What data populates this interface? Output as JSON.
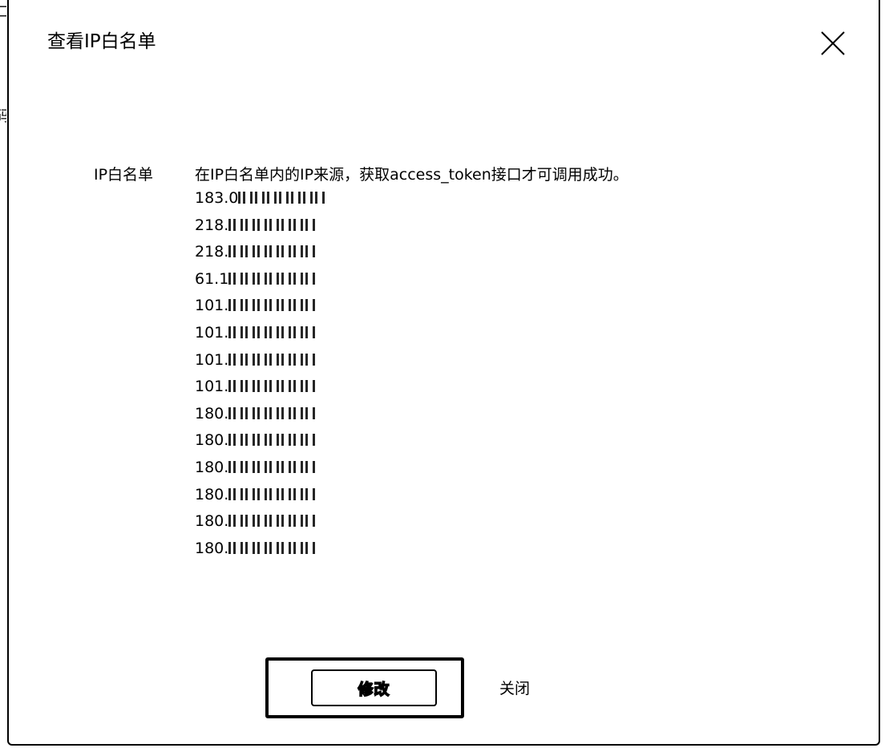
{
  "background": {
    "fragment_left_1": "口",
    "fragment_left_2": "码"
  },
  "dialog": {
    "title": "查看IP白名单",
    "close_icon": "close-icon",
    "field_label": "IP白名单",
    "description": "在IP白名单内的IP来源，获取access_token接口才可调用成功。",
    "ip_prefixes": [
      "183.0",
      "218.",
      "218.",
      "61.1",
      "101.",
      "101.",
      "101.",
      "101.",
      "180.",
      "180.",
      "180.",
      "180.",
      "180.",
      "180."
    ],
    "edit_label": "修改",
    "close_label": "关闭"
  }
}
